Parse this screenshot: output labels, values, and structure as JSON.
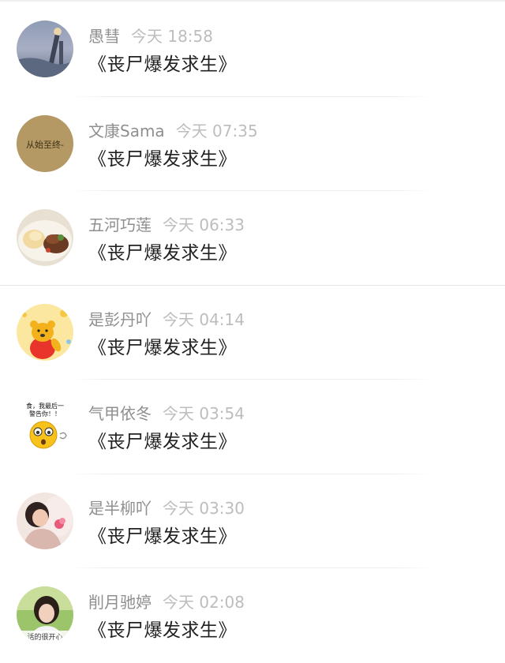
{
  "comments": [
    {
      "user": "愚彗",
      "time": "今天 18:58",
      "text": "《丧尸爆发求生》",
      "avatar": "foggy-lake-avatar"
    },
    {
      "user": "文康Sama",
      "time": "今天 07:35",
      "text": "《丧尸爆发求生》",
      "avatar": "calligraphy-text-avatar",
      "avatar_text": "从始至终-"
    },
    {
      "user": "五河巧莲",
      "time": "今天 06:33",
      "text": "《丧尸爆发求生》",
      "avatar": "food-plate-avatar"
    },
    {
      "user": "是彭丹吖",
      "time": "今天 04:14",
      "text": "《丧尸爆发求生》",
      "avatar": "winnie-the-pooh-avatar"
    },
    {
      "user": "气甲依冬",
      "time": "今天 03:54",
      "text": "《丧尸爆发求生》",
      "avatar": "shocked-emoji-avatar",
      "avatar_text_1": "食，我最后一",
      "avatar_text_2": "警告你！！"
    },
    {
      "user": "是半柳吖",
      "time": "今天 03:30",
      "text": "《丧尸爆发求生》",
      "avatar": "child-photo-avatar"
    },
    {
      "user": "削月驰婷",
      "time": "今天 02:08",
      "text": "《丧尸爆发求生》",
      "avatar": "smiling-girl-avatar",
      "avatar_text": "活的很开心"
    }
  ]
}
